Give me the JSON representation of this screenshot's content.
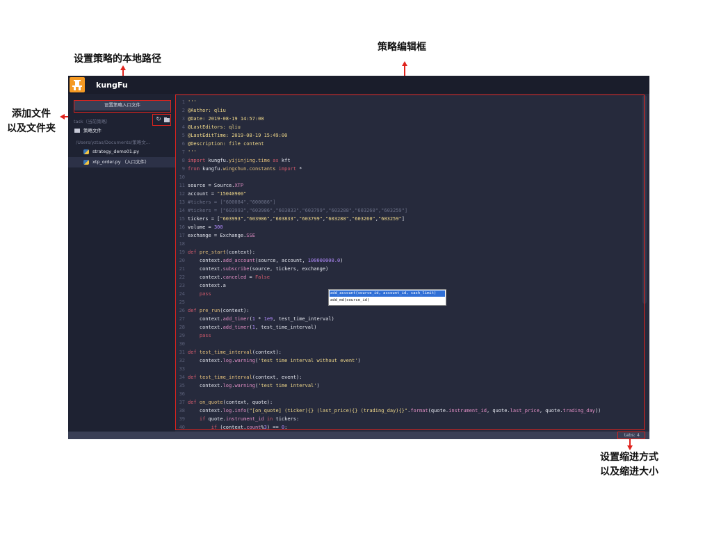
{
  "annotations": {
    "local_path": "设置策略的本地路径",
    "editor_box": "策略编辑框",
    "add_file_line1": "添加文件",
    "add_file_line2": "以及文件夹",
    "indent_line1": "设置缩进方式",
    "indent_line2": "以及缩进大小"
  },
  "app": {
    "logo_text": "kungFu",
    "entry_button": "设置策略入口文件",
    "task_label": "task（当前策略）",
    "folder_label": "策略文件",
    "path_label": "/Users/yztas/Documents/策略文...",
    "files": [
      {
        "name": "strategy_demo01.py",
        "active": false
      },
      {
        "name": "xtp_order.py （入口文件）",
        "active": true
      }
    ],
    "status": "tabs: 4"
  },
  "autocomplete": [
    "add_account(source_id, account_id, cash_limit)",
    "add_md(source_id)"
  ],
  "colors": {
    "annotation": "#e0231d",
    "app_bg": "#262a3c",
    "sidebar_bg": "#1e2232",
    "logo": "#f59a23"
  }
}
